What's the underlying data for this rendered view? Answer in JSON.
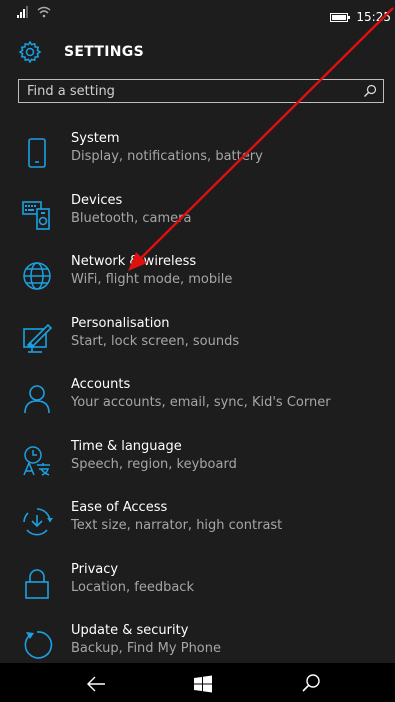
{
  "status_bar": {
    "time": "15:25",
    "signal_icon": "signal-bars-icon",
    "wifi_icon": "wifi-icon",
    "battery_icon": "battery-icon"
  },
  "header": {
    "title": "SETTINGS",
    "icon": "gear-icon"
  },
  "search": {
    "placeholder": "Find a setting",
    "icon": "search-icon"
  },
  "items": [
    {
      "label": "System",
      "sub": "Display, notifications, battery",
      "icon": "phone-icon"
    },
    {
      "label": "Devices",
      "sub": "Bluetooth, camera",
      "icon": "devices-icon"
    },
    {
      "label": "Network & wireless",
      "sub": "WiFi, flight mode, mobile",
      "icon": "globe-icon"
    },
    {
      "label": "Personalisation",
      "sub": "Start, lock screen, sounds",
      "icon": "paint-icon"
    },
    {
      "label": "Accounts",
      "sub": "Your accounts, email, sync, Kid's Corner",
      "icon": "person-icon"
    },
    {
      "label": "Time & language",
      "sub": "Speech, region, keyboard",
      "icon": "time-language-icon"
    },
    {
      "label": "Ease of Access",
      "sub": "Text size, narrator, high contrast",
      "icon": "ease-of-access-icon"
    },
    {
      "label": "Privacy",
      "sub": "Location, feedback",
      "icon": "lock-icon"
    },
    {
      "label": "Update & security",
      "sub": "Backup, Find My Phone",
      "icon": "update-icon"
    }
  ],
  "navbar": {
    "back_icon": "back-arrow-icon",
    "start_icon": "windows-logo-icon",
    "search_icon": "search-icon"
  },
  "colors": {
    "background": "#1d1d1d",
    "accent": "#1ba1e2",
    "annotation": "#e01010",
    "subtext": "#a6a6a6"
  }
}
